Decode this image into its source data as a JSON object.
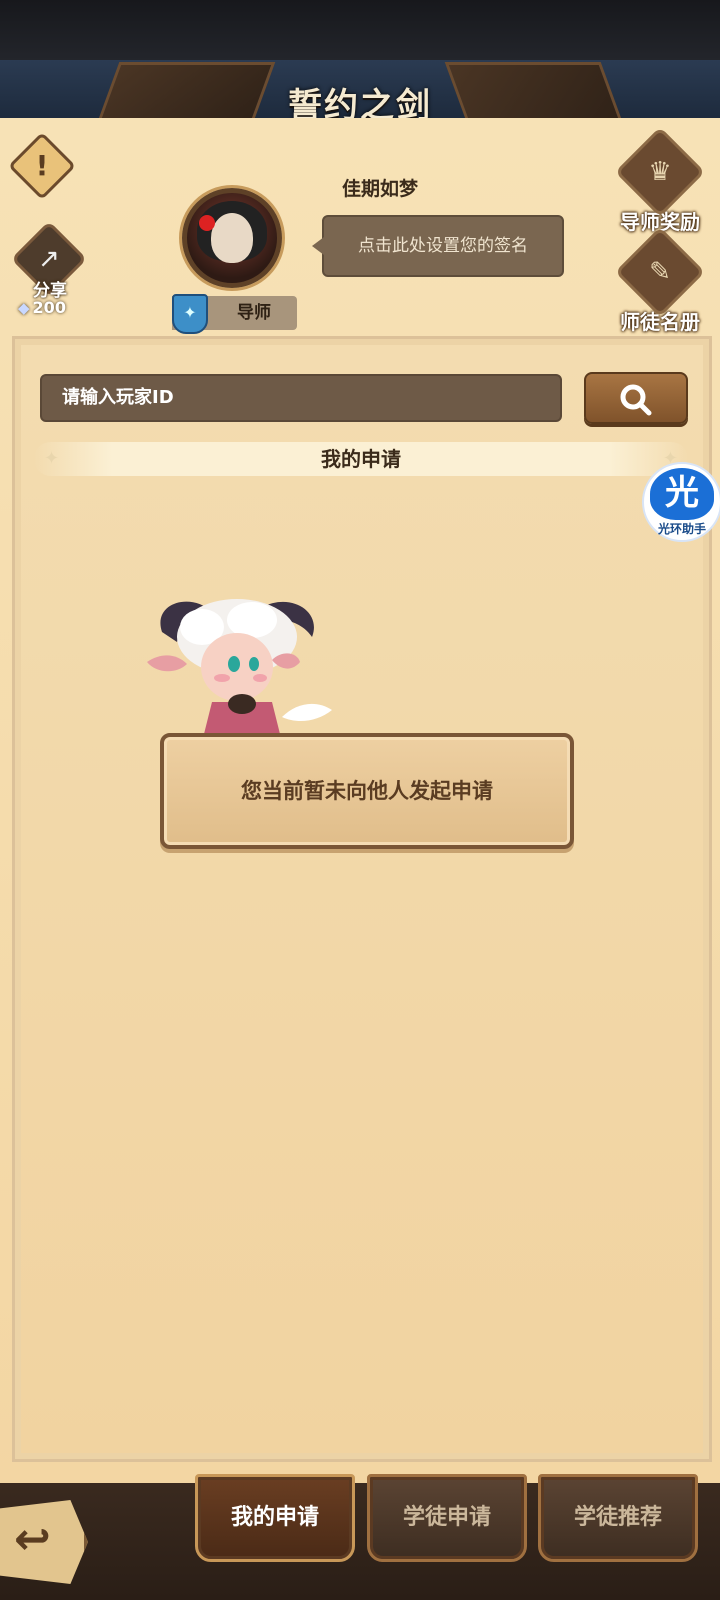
{
  "header": {
    "title": "誓约之剑"
  },
  "profile": {
    "name": "佳期如梦",
    "signature_placeholder": "点击此处设置您的签名",
    "role": "导师"
  },
  "left_actions": {
    "alert_icon": "exclamation-icon",
    "share_label": "分享",
    "gem_count": "200"
  },
  "right_actions": [
    {
      "label": "导师奖励",
      "icon": "crown-icon"
    },
    {
      "label": "师徒名册",
      "icon": "scroll-icon"
    }
  ],
  "search": {
    "placeholder": "请输入玩家ID"
  },
  "section_title": "我的申请",
  "empty_message": "您当前暂未向他人发起申请",
  "assistant_badge": {
    "glyph": "光",
    "label": "光环助手"
  },
  "tabs": [
    {
      "label": "我的申请",
      "active": true
    },
    {
      "label": "学徒申请",
      "active": false
    },
    {
      "label": "学徒推荐",
      "active": false
    }
  ]
}
